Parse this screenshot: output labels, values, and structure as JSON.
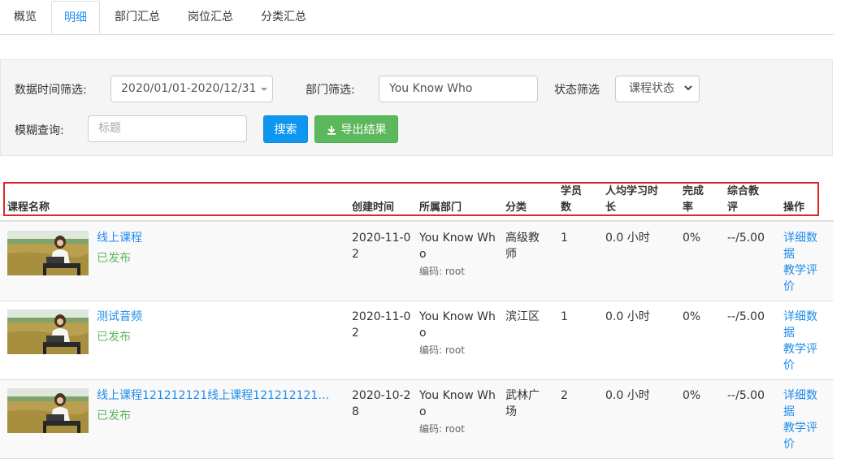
{
  "tabs": [
    {
      "label": "概览"
    },
    {
      "label": "明细"
    },
    {
      "label": "部门汇总"
    },
    {
      "label": "岗位汇总"
    },
    {
      "label": "分类汇总"
    }
  ],
  "filters": {
    "date_label": "数据时间筛选:",
    "date_value": "2020/01/01-2020/12/31",
    "dept_label": "部门筛选:",
    "dept_value": "You Know Who",
    "status_label": "状态筛选",
    "status_value": "课程状态",
    "fuzzy_label": "模糊查询:",
    "fuzzy_placeholder": "标题",
    "search_button": "搜索",
    "export_button": "导出结果"
  },
  "table": {
    "headers": {
      "name": "课程名称",
      "created": "创建时间",
      "dept": "所属部门",
      "category": "分类",
      "students_1": "学员",
      "students_2": "数",
      "avg_time_1": "人均学习时",
      "avg_time_2": "长",
      "completion_1": "完成",
      "completion_2": "率",
      "rating_1": "综合教",
      "rating_2": "评",
      "ops": "操作"
    },
    "rows": [
      {
        "title": "线上课程",
        "status": "已发布",
        "created_1": "2020-11-0",
        "created_2": "2",
        "dept_1": "You Know Wh",
        "dept_2": "o",
        "code": "编码: root",
        "category_1": "高级教",
        "category_2": "师",
        "students": "1",
        "avg_time": "0.0 小时",
        "completion": "0%",
        "rating": "--/5.00",
        "op_detail_1": "详细数",
        "op_detail_2": "据",
        "op_eval_1": "教学评",
        "op_eval_2": "价"
      },
      {
        "title": "测试音频",
        "status": "已发布",
        "created_1": "2020-11-0",
        "created_2": "2",
        "dept_1": "You Know Wh",
        "dept_2": "o",
        "code": "编码: root",
        "category_1": "滨江区",
        "category_2": "",
        "students": "1",
        "avg_time": "0.0 小时",
        "completion": "0%",
        "rating": "--/5.00",
        "op_detail_1": "详细数",
        "op_detail_2": "据",
        "op_eval_1": "教学评",
        "op_eval_2": "价"
      },
      {
        "title": "线上课程121212121线上课程121212121线上...",
        "status": "已发布",
        "created_1": "2020-10-2",
        "created_2": "8",
        "dept_1": "You Know Wh",
        "dept_2": "o",
        "code": "编码: root",
        "category_1": "武林广",
        "category_2": "场",
        "students": "2",
        "avg_time": "0.0 小时",
        "completion": "0%",
        "rating": "--/5.00",
        "op_detail_1": "详细数",
        "op_detail_2": "据",
        "op_eval_1": "教学评",
        "op_eval_2": "价"
      }
    ]
  }
}
